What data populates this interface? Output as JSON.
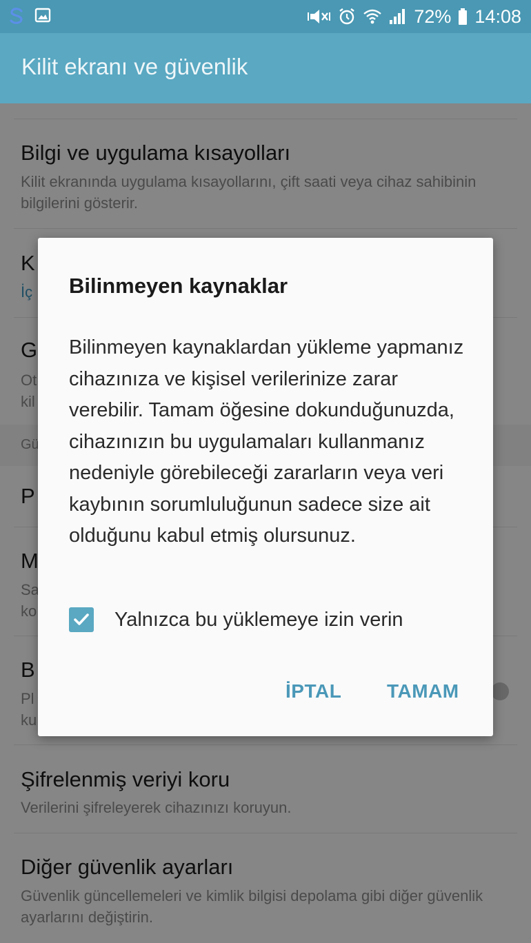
{
  "status_bar": {
    "left_icons": [
      "s-app-icon",
      "image-icon"
    ],
    "right_icons": [
      "mute-icon",
      "alarm-icon",
      "wifi-icon",
      "signal-icon"
    ],
    "battery": "72%",
    "time": "14:08"
  },
  "app_bar": {
    "title": "Kilit ekranı ve güvenlik"
  },
  "settings": {
    "item_info": {
      "title": "Bilgi ve uygulama kısayolları",
      "subtitle": "Kilit ekranında uygulama kısayollarını, çift saati veya cihaz sahibinin bilgilerini gösterir."
    },
    "item_k": {
      "title": "K",
      "subtitle": "İç"
    },
    "item_g": {
      "title": "G",
      "subtitle_line1": "Ot",
      "subtitle_line2": "kil"
    },
    "section_gu": "Gü",
    "item_p": {
      "title": "P"
    },
    "item_m": {
      "title": "M",
      "subtitle_line1": "Sa",
      "subtitle_line2": "ko"
    },
    "item_b": {
      "title": "B",
      "subtitle_line1": "Pl",
      "subtitle_line2": "ku"
    },
    "item_encrypt": {
      "title": "Şifrelenmiş veriyi koru",
      "subtitle": "Verilerini şifreleyerek cihazınızı koruyun."
    },
    "item_other": {
      "title": "Diğer güvenlik ayarları",
      "subtitle": "Güvenlik güncellemeleri ve kimlik bilgisi depolama gibi diğer güvenlik ayarlarını değiştirin."
    }
  },
  "dialog": {
    "title": "Bilinmeyen kaynaklar",
    "body": "Bilinmeyen kaynaklardan yükleme yapmanız cihazınıza ve kişisel verilerinize zarar verebilir. Tamam öğesine dokunduğunuzda, cihazınızın bu uygulamaları kullanmanız nedeniyle görebileceği zararların veya veri kaybının sorumluluğunun sadece size ait olduğunu kabul etmiş olursunuz.",
    "checkbox_label": "Yalnızca bu yüklemeye izin verin",
    "checkbox_checked": true,
    "cancel_label": "İPTAL",
    "ok_label": "TAMAM"
  },
  "colors": {
    "status_bar": "#4a98b3",
    "app_bar": "#5aa8c2",
    "accent": "#4a98b8"
  }
}
